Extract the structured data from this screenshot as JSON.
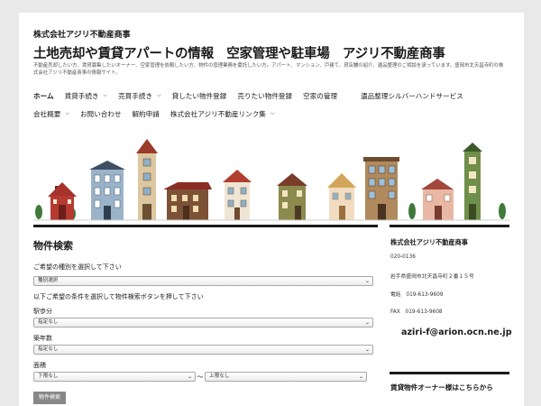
{
  "header": {
    "site_name": "株式会社アジリ不動産商事",
    "title": "土地売却や賃貸アパートの情報　空家管理や駐車場　アジリ不動産商事",
    "description": "不動産売却したい方、賃貸募集したいオーナー、空家管理を依頼したい方、物件の管理業務を委託したい方。アパート、マンション、戸建て、貸店舗の紹介、遺品整理のご相談を承っています。盛岡市北天昌寺町の株式会社アジリ不動産商事の情報サイト。"
  },
  "nav": {
    "row1": [
      {
        "label": "ホーム",
        "dropdown": false,
        "active": true
      },
      {
        "label": "賃貸手続き",
        "dropdown": true,
        "active": false
      },
      {
        "label": "売買手続き",
        "dropdown": true,
        "active": false
      },
      {
        "label": "貸したい物件登録",
        "dropdown": false,
        "active": false
      },
      {
        "label": "売りたい物件登録",
        "dropdown": false,
        "active": false
      },
      {
        "label": "空家の管理",
        "dropdown": false,
        "active": false
      },
      {
        "label": "遺品整理シルバーハンドサービス",
        "dropdown": false,
        "active": false
      }
    ],
    "row2": [
      {
        "label": "会社概要",
        "dropdown": true,
        "active": false
      },
      {
        "label": "お問い合わせ",
        "dropdown": false,
        "active": false
      },
      {
        "label": "解約申請",
        "dropdown": false,
        "active": false
      },
      {
        "label": "株式会社アジリ不動産リンク集",
        "dropdown": true,
        "active": false
      }
    ]
  },
  "search": {
    "title": "物件検索",
    "type_prompt": "ご希望の種別を選択して下さい",
    "type_value": "種別選択",
    "condition_prompt": "以下ご希望の条件を選択して物件検索ボタンを押して下さい",
    "station_label": "駅歩分",
    "station_value": "指定なし",
    "age_label": "築年数",
    "age_value": "指定なし",
    "area_label": "面積",
    "area_min": "下限なし",
    "tilde": "～",
    "area_max": "上限なし",
    "button_label": "物件検索"
  },
  "sidebar": {
    "company": "株式会社アジリ不動産商事",
    "postal": "020-0136",
    "address": "岩手県盛岡市北天昌寺町２番１５号",
    "phone": "電話　019-613-9609",
    "fax": "FAX　019-613-9608",
    "email": "aziri-f@arion.ocn.ne.jp",
    "owner_heading": "賃貸物件オーナー様はこちらから"
  },
  "icons": {
    "dropdown": "chevron-down-icon",
    "select_arrow": "select-arrow-icon"
  },
  "colors": {
    "text": "#1a1a1a",
    "page_bg": "#e9e9e9",
    "content_bg": "#ffffff",
    "divider": "#1a1a1a"
  }
}
